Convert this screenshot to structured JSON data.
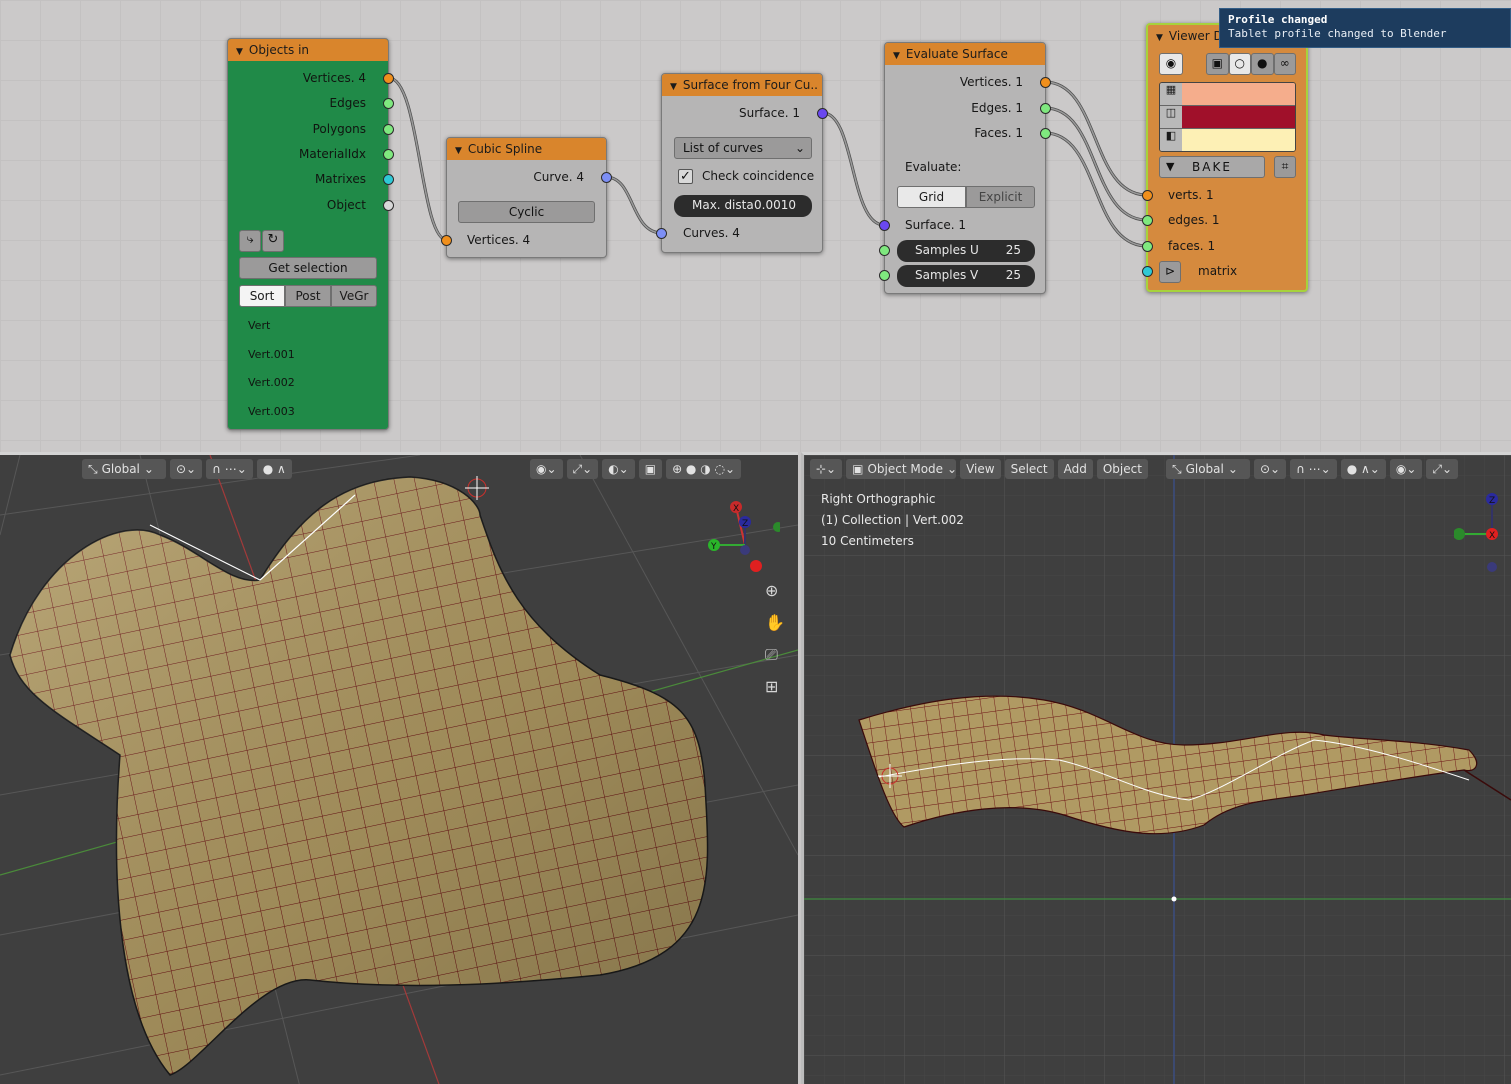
{
  "tooltip": {
    "title": "Profile changed",
    "message": "Tablet profile changed to Blender"
  },
  "nodes": {
    "objects_in": {
      "title": "Objects in",
      "outputs": [
        "Vertices. 4",
        "Edges",
        "Polygons",
        "MaterialIdx",
        "Matrixes",
        "Object"
      ],
      "get_selection": "Get selection",
      "tabs": [
        "Sort",
        "Post",
        "VeGr"
      ],
      "objects": [
        "Vert",
        "Vert.001",
        "Vert.002",
        "Vert.003"
      ]
    },
    "cubic_spline": {
      "title": "Cubic Spline",
      "output": "Curve. 4",
      "cyclic": "Cyclic",
      "input": "Vertices. 4"
    },
    "surface_from_curves": {
      "title": "Surface from Four Cu..",
      "output": "Surface. 1",
      "mode": "List of curves",
      "check_label": "Check coincidence",
      "max_dist_label": "Max. dista",
      "max_dist_value": "0.0010",
      "input": "Curves. 4"
    },
    "evaluate_surface": {
      "title": "Evaluate Surface",
      "outputs": [
        "Vertices. 1",
        "Edges. 1",
        "Faces. 1"
      ],
      "evaluate_label": "Evaluate:",
      "modes": [
        "Grid",
        "Explicit"
      ],
      "input": "Surface. 1",
      "samples_u_label": "Samples U",
      "samples_u": "25",
      "samples_v_label": "Samples V",
      "samples_v": "25"
    },
    "viewer": {
      "title": "Viewer D",
      "bake": "BAKE",
      "inputs": [
        "verts. 1",
        "edges. 1",
        "faces. 1",
        "matrix"
      ],
      "colors": [
        "#f5ad8c",
        "#a0102a",
        "#fdf0b5"
      ]
    }
  },
  "viewport_left": {
    "orientation": "Global"
  },
  "viewport_right": {
    "mode": "Object Mode",
    "menus": [
      "View",
      "Select",
      "Add",
      "Object"
    ],
    "orientation": "Global",
    "info": [
      "Right Orthographic",
      "(1) Collection | Vert.002",
      "10 Centimeters"
    ]
  },
  "colors": {
    "node_header": "#d9852c",
    "objects_in_body": "#208a48",
    "surface_fill": "#b09a63",
    "grid_wire": "#6b0f12"
  }
}
